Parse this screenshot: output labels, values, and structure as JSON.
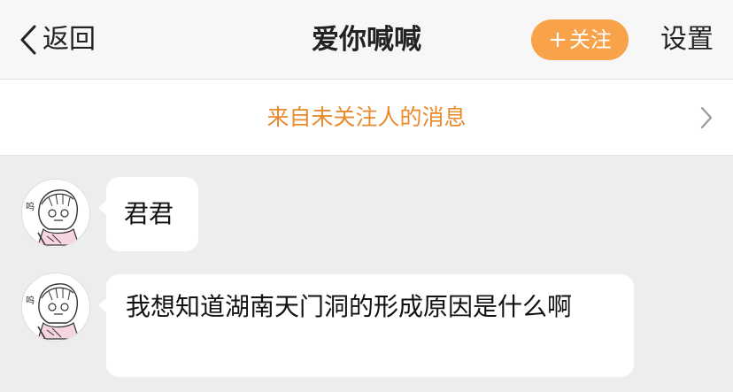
{
  "header": {
    "back_label": "返回",
    "title": "爱你喊喊",
    "follow_plus": "+",
    "follow_label": "关注",
    "settings_label": "设置"
  },
  "notice": {
    "text": "来自未关注人的消息"
  },
  "messages": [
    {
      "avatar_caption": "呜",
      "text": "君君"
    },
    {
      "avatar_caption": "呜",
      "text": "我想知道湖南天门洞的形成原因是什么啊"
    }
  ],
  "colors": {
    "accent_orange": "#f8a24a",
    "notice_text": "#e88a2e",
    "chat_background": "#ededed"
  }
}
